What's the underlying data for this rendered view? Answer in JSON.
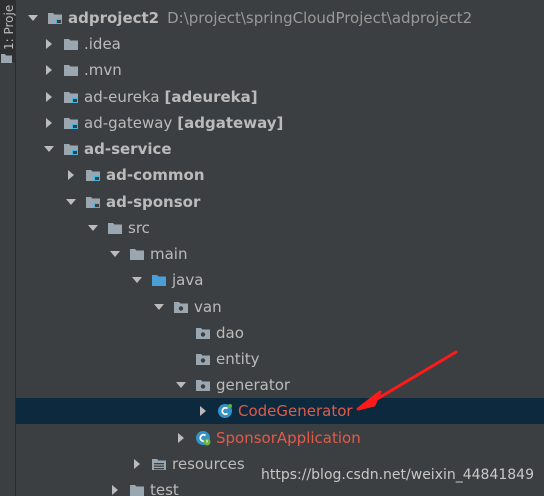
{
  "sidebar": {
    "tab_label": "1: Proje"
  },
  "tree": [
    {
      "label": "adproject2",
      "path": "D:\\project\\springCloudProject\\adproject2",
      "icon": "module-folder-icon",
      "expanded": true,
      "bold": true
    },
    {
      "label": ".idea",
      "icon": "folder-icon",
      "expanded": false
    },
    {
      "label": ".mvn",
      "icon": "folder-icon",
      "expanded": false
    },
    {
      "label": "ad-eureka",
      "suffix": "[adeureka]",
      "icon": "module-folder-icon",
      "expanded": false
    },
    {
      "label": "ad-gateway",
      "suffix": "[adgateway]",
      "icon": "module-folder-icon",
      "expanded": false
    },
    {
      "label": "ad-service",
      "icon": "module-folder-icon",
      "expanded": true,
      "bold": true
    },
    {
      "label": "ad-common",
      "icon": "module-folder-icon",
      "expanded": false,
      "bold": true
    },
    {
      "label": "ad-sponsor",
      "icon": "module-folder-icon",
      "expanded": true,
      "bold": true
    },
    {
      "label": "src",
      "icon": "folder-icon",
      "expanded": true
    },
    {
      "label": "main",
      "icon": "folder-icon",
      "expanded": true
    },
    {
      "label": "java",
      "icon": "source-folder-icon",
      "expanded": true
    },
    {
      "label": "van",
      "icon": "package-icon",
      "expanded": true
    },
    {
      "label": "dao",
      "icon": "package-icon"
    },
    {
      "label": "entity",
      "icon": "package-icon"
    },
    {
      "label": "generator",
      "icon": "package-icon",
      "expanded": true
    },
    {
      "label": "CodeGenerator",
      "icon": "java-class-icon",
      "expanded": false,
      "selected": true
    },
    {
      "label": "SponsorApplication",
      "icon": "spring-boot-class-icon",
      "expanded": false
    },
    {
      "label": "resources",
      "icon": "resources-folder-icon",
      "expanded": false
    },
    {
      "label": "test",
      "icon": "folder-icon",
      "expanded": false
    }
  ],
  "watermark": "https://blog.csdn.net/weixin_44841849",
  "colors": {
    "background": "#3c3f41",
    "selection": "#0d293e",
    "text": "#bbbbbb",
    "modified_red": "#e05b4b",
    "annotation_arrow": "#ff1a1a"
  }
}
